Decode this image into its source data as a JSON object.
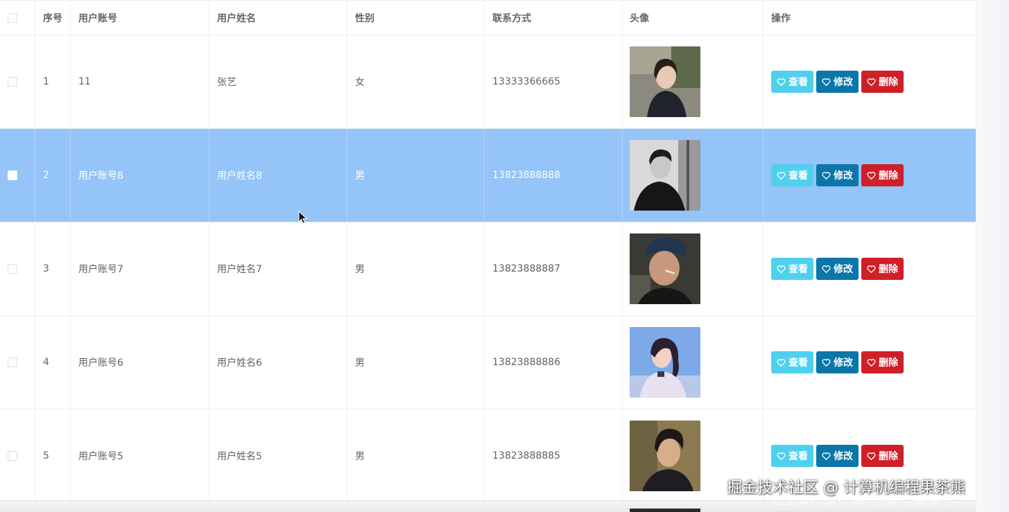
{
  "table": {
    "headers": [
      "序号",
      "用户账号",
      "用户姓名",
      "性别",
      "联系方式",
      "头像",
      "操作"
    ],
    "rows": [
      {
        "index": "1",
        "account": "11",
        "name": "张艺",
        "gender": "女",
        "phone": "13333366665",
        "selected": false
      },
      {
        "index": "2",
        "account": "用户账号8",
        "name": "用户姓名8",
        "gender": "男",
        "phone": "13823888888",
        "selected": true
      },
      {
        "index": "3",
        "account": "用户账号7",
        "name": "用户姓名7",
        "gender": "男",
        "phone": "13823888887",
        "selected": false
      },
      {
        "index": "4",
        "account": "用户账号6",
        "name": "用户姓名6",
        "gender": "男",
        "phone": "13823888886",
        "selected": false
      },
      {
        "index": "5",
        "account": "用户账号5",
        "name": "用户姓名5",
        "gender": "男",
        "phone": "13823888885",
        "selected": false
      }
    ],
    "actions": {
      "view": "查看",
      "edit": "修改",
      "delete": "删除"
    }
  },
  "icons": {
    "action_icon": "heart-icon",
    "cursor": "cursor-icon"
  },
  "colors": {
    "selected_row": "#94c4f8",
    "view_button": "#4fd1ee",
    "edit_button": "#0b76a8",
    "delete_button": "#cf1f29"
  },
  "watermark": {
    "text": "掘金技术社区 @ 计算机编程果茶熊",
    "ghost": "CSDN @计算机编程果茶熊"
  }
}
